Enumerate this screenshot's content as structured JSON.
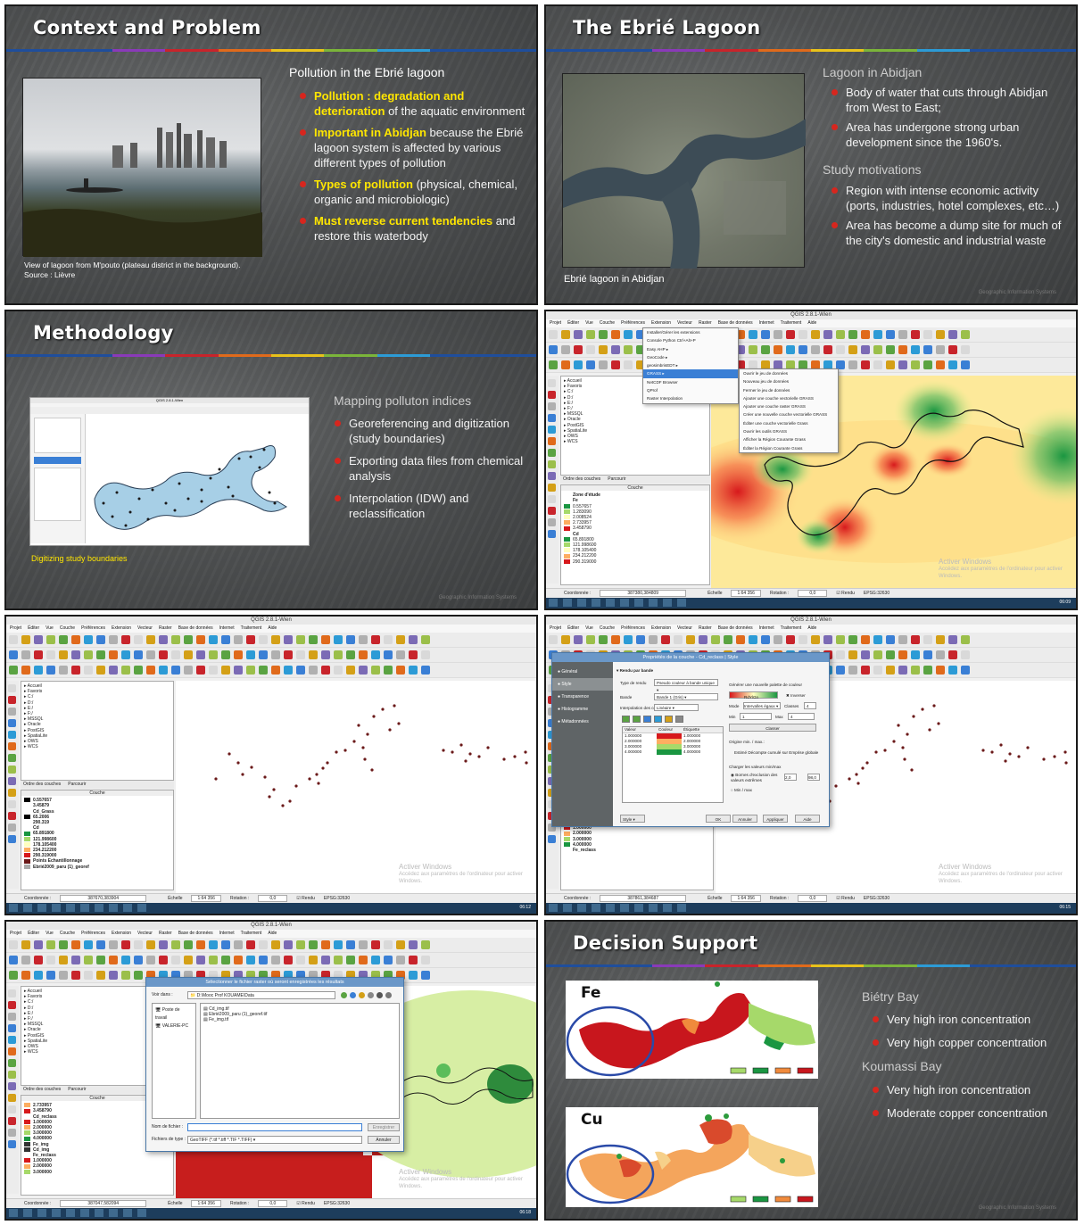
{
  "colors": {
    "rainbow": [
      "#1f4e9c",
      "#1f4e9c",
      "#8a3ab9",
      "#c8242b",
      "#e06a1b",
      "#e8c21a",
      "#7bb53a",
      "#2c9bd6",
      "#1f4e9c",
      "#1f4e9c"
    ],
    "bullet": "#d7261e",
    "highlight": "#ffe600",
    "orange": "#f0b400"
  },
  "slide1": {
    "title": "Context and Problem",
    "subtitle": "Pollution in the Ebrié lagoon",
    "bullets": [
      {
        "hl": "Pollution : degradation and deterioration",
        "rest": " of the aquatic environment"
      },
      {
        "hl": "Important in Abidjan",
        "rest": " because the Ebrié lagoon system is affected by various different types of pollution"
      },
      {
        "hl": "Types of pollution",
        "rest": " (physical, chemical, organic and microbiologic)"
      },
      {
        "hl": "Must reverse current tendencies",
        "rest": " and restore this waterbody"
      }
    ],
    "caption_line1": "View of lagoon from M'pouto (plateau district in the background).",
    "caption_line2": "Source : Lièvre"
  },
  "slide2": {
    "title": "The Ebrié Lagoon",
    "section1": "Lagoon in Abidjan",
    "bullets1": [
      "Body of water that cuts through Abidjan from West to East;",
      "Area has undergone strong urban development since the 1960's."
    ],
    "section2": "Study motivations",
    "bullets2": [
      "Region with intense economic activity (ports, industries, hotel complexes, etc…)",
      "Area has become a dump site for much of the city's domestic and industrial waste"
    ],
    "caption": "Ebrié lagoon in Abidjan",
    "watermark": "Geographic Information Systems"
  },
  "slide3": {
    "title": "Methodology",
    "section": "Mapping polluton indices",
    "bullets": [
      "Georeferencing and digitization (study boundaries)",
      "Exporting data files from chemical analysis",
      "Interpolation (IDW) and reclassification"
    ],
    "caption": "Digitizing study boundaries",
    "qgis_title": "QGIS 2.8.1-Wien",
    "watermark": "Geographic Information Systems"
  },
  "qgis": {
    "title": "QGIS 2.8.1-Wien",
    "menu": [
      "Projet",
      "Éditer",
      "Vue",
      "Couche",
      "Préférences",
      "Extension",
      "Vecteur",
      "Raster",
      "Base de données",
      "Internet",
      "Traitement",
      "Aide"
    ],
    "browser_tabs": [
      "Ordre des couches",
      "Parcourir"
    ],
    "browser_items": [
      "Accueil",
      "Favoris",
      "C:/",
      "D:/",
      "E:/",
      "F:/",
      "MSSQL",
      "Oracle",
      "PostGIS",
      "SpatiaLite",
      "OWS",
      "WCS"
    ],
    "layers_header": "Couche",
    "status_coord_label": "Coordonnée :",
    "status_scale_label": "Échelle",
    "status_scale": "1:64 356",
    "status_rotation_label": "Rotation :",
    "status_rotation": "0,0",
    "status_render": "Rendu",
    "status_epsg": "EPSG:32630",
    "activate_title": "Activer Windows",
    "activate_text": "Accédez aux paramètres de l'ordinateur pour activer Windows."
  },
  "shot4": {
    "coord": "387380,384809",
    "clock": "06:09",
    "extension_menu": [
      "Installer/Gérer les extensions",
      "Console Python",
      "Easy AHP",
      "GeoCode",
      "geosimbrisEDT",
      "GRASS",
      "NetCDF Browser",
      "QProf",
      "Raster Interpolation"
    ],
    "console_shortcut": "Ctrl+Alt+P",
    "grass_menu": [
      "Ouvrir le jeu de données",
      "Nouveau jeu de données",
      "Fermer le jeu de données",
      "Ajouter une couche vectorielle GRASS",
      "Ajouter une couche raster GRASS",
      "Créer une nouvelle couche vectorielle GRASS",
      "Éditer une couche vectorielle Grass",
      "Ouvrir les outils GRASS",
      "Afficher la Région Courante Grass",
      "Éditer la Région Courante Grass"
    ],
    "layers": [
      {
        "name": "Zone d'étude",
        "bold": true
      },
      {
        "name": "Fe",
        "bold": true
      },
      {
        "name": "0.557657"
      },
      {
        "name": "1.283090"
      },
      {
        "name": "2.008524"
      },
      {
        "name": "2.733957"
      },
      {
        "name": "3.458790"
      },
      {
        "name": "Cd",
        "bold": true
      },
      {
        "name": "65.891800"
      },
      {
        "name": "121.998600"
      },
      {
        "name": "178.105400"
      },
      {
        "name": "234.212200"
      },
      {
        "name": "290.319000"
      }
    ]
  },
  "shot5": {
    "coord": "387670,383904",
    "clock": "06:12",
    "layers": [
      "0.557657",
      "3.45879",
      "Cd_Grass",
      "65.2006",
      "290.319",
      "Cd",
      "65.891800",
      "121.998600",
      "178.105400",
      "234.212200",
      "290.319000",
      "Points Echantillonnage",
      "Ebrié2009_paru (1)_georef"
    ]
  },
  "shot6": {
    "coord": "387861,384687",
    "clock": "06:15",
    "dialog_title": "Propriétés de la couche - Cd_reclass | Style",
    "sidebar": [
      "Général",
      "Style",
      "Transparence",
      "Histogramme",
      "Métadonnées"
    ],
    "render_label": "Rendu par bande",
    "render_type_label": "Type de rendu",
    "render_type": "Pseudo couleur à bande unique",
    "band_label": "Bande",
    "band": "Bande 1 (Gris)",
    "interp_label": "Interpolation des couleurs",
    "interp": "Linéaire",
    "palette_label": "Générer une nouvelle palette de couleur",
    "palette": "RdYlGn",
    "invert": "Inverser",
    "mode_label": "Mode",
    "mode": "Intervalles égaux",
    "classes_label": "Classes",
    "classes": "4",
    "min_label": "Min",
    "min": "1",
    "max_label": "Max",
    "max": "4",
    "classify": "Classer",
    "origin_label": "Origine min. / max.:",
    "origin_text": "Estimé Décompte cumulé sur Emprise globale",
    "load_label": "Charger les valeurs min/max",
    "cut_label": "Bornes d'exclusion des valeurs extrêmes",
    "cut_from": "2,0",
    "cut_to": "98,0",
    "minmax": "Min / max",
    "table_headers": [
      "Valeur",
      "Couleur",
      "Étiquette"
    ],
    "table_rows": [
      {
        "v": "1.000000",
        "c": "#d7191c",
        "l": "1.000000"
      },
      {
        "v": "2.000000",
        "c": "#fdae61",
        "l": "2.000000"
      },
      {
        "v": "3.000000",
        "c": "#a6d96a",
        "l": "3.000000"
      },
      {
        "v": "4.000000",
        "c": "#1a9641",
        "l": "4.000000"
      }
    ],
    "style_btn": "Style",
    "ok": "OK",
    "cancel": "Annuler",
    "apply": "Appliquer",
    "help": "Aide",
    "layers": [
      "1.283090",
      "2.008524",
      "2.733957",
      "3.458790",
      "Cd_reclass",
      "1.000000",
      "2.000000",
      "3.000000",
      "4.000000",
      "Fe_reclass"
    ]
  },
  "shot7": {
    "coord": "387047,582094",
    "clock": "06:18",
    "dialog_title": "Sélectionner le fichier raster où seront enregistrées les résultats",
    "look_in_label": "Voir dans :",
    "look_in": "D:\\Mooc Prof KOUAME\\Data",
    "places": [
      "Poste de travail",
      "VALERIE-PC"
    ],
    "files": [
      "Cd_img.tif",
      "Ebrié2009_paru (1)_georef.tif",
      "Fe_img.tif"
    ],
    "filename_label": "Nom de fichier :",
    "filetype_label": "Fichiers de type :",
    "filetype": "GeoTIFF (*.tif *.tiff *.TIF *.TIFF)",
    "save": "Enregistrer",
    "cancel": "Annuler",
    "layers": [
      "2.733957",
      "3.458790",
      "Cd_reclass",
      "1.000000",
      "2.000000",
      "3.000000",
      "4.000000",
      "Fe_img",
      "Cd_img",
      "Fe_reclass",
      "1.000000",
      "2.000000",
      "3.000000"
    ]
  },
  "slide8": {
    "title": "Decision Support",
    "map1_label": "Fe",
    "map2_label": "Cu",
    "section1": "Biétry Bay",
    "bullets1": [
      "Very high iron concentration",
      "Very high copper concentration"
    ],
    "section2": "Koumassi Bay",
    "bullets2": [
      "Very high iron concentration",
      "Moderate copper concentration"
    ],
    "legend_colors": [
      "#a6d96a",
      "#1a9641",
      "#f08a3c",
      "#c8161d"
    ],
    "watermark": "Geographic Information Systems"
  }
}
